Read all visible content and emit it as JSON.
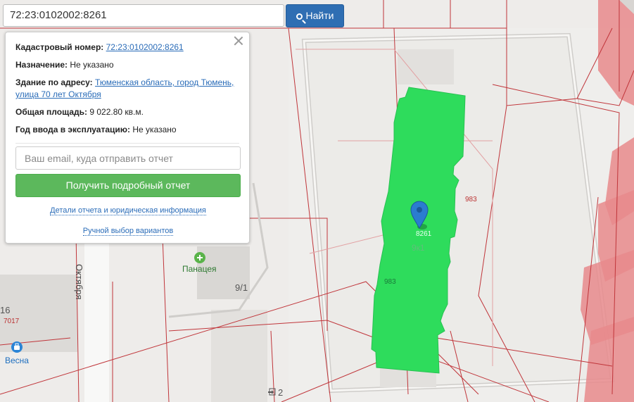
{
  "search": {
    "value": "72:23:0102002:8261",
    "button_label": "Найти"
  },
  "popup": {
    "cadastral_label": "Кадастровый номер:",
    "cadastral_value": "72:23:0102002:8261",
    "purpose_label": "Назначение:",
    "purpose_value": "Не указано",
    "address_label": "Здание по адресу:",
    "address_value": "Тюменская область, город Тюмень, улица 70 лет Октября",
    "area_label": "Общая площадь:",
    "area_value": "9 022.80 кв.м.",
    "year_label": "Год ввода в эксплуатацию:",
    "year_value": "Не указано",
    "email_placeholder": "Ваш email, куда отправить отчет",
    "report_button": "Получить подробный отчет",
    "details_link": "Детали отчета и юридическая информация",
    "manual_link": "Ручной выбор вариантов"
  },
  "map": {
    "street_name": "Октября",
    "poi_pharmacy": "Панацея",
    "poi_store": "Весна",
    "house_9_1": "9/1",
    "house_16": "16",
    "parcel_7017": "7017",
    "parcel_983_right": "983",
    "parcel_983_green": "983",
    "parcel_8261": "8261",
    "building_9a1": "9к1",
    "entrance_2": "2"
  },
  "colors": {
    "selected_parcel": "#2edc5c",
    "parcel_border": "#c0353a",
    "neighbor_building": "#e8898c",
    "button_blue": "#2f6eb3",
    "button_green": "#5cb85c"
  }
}
